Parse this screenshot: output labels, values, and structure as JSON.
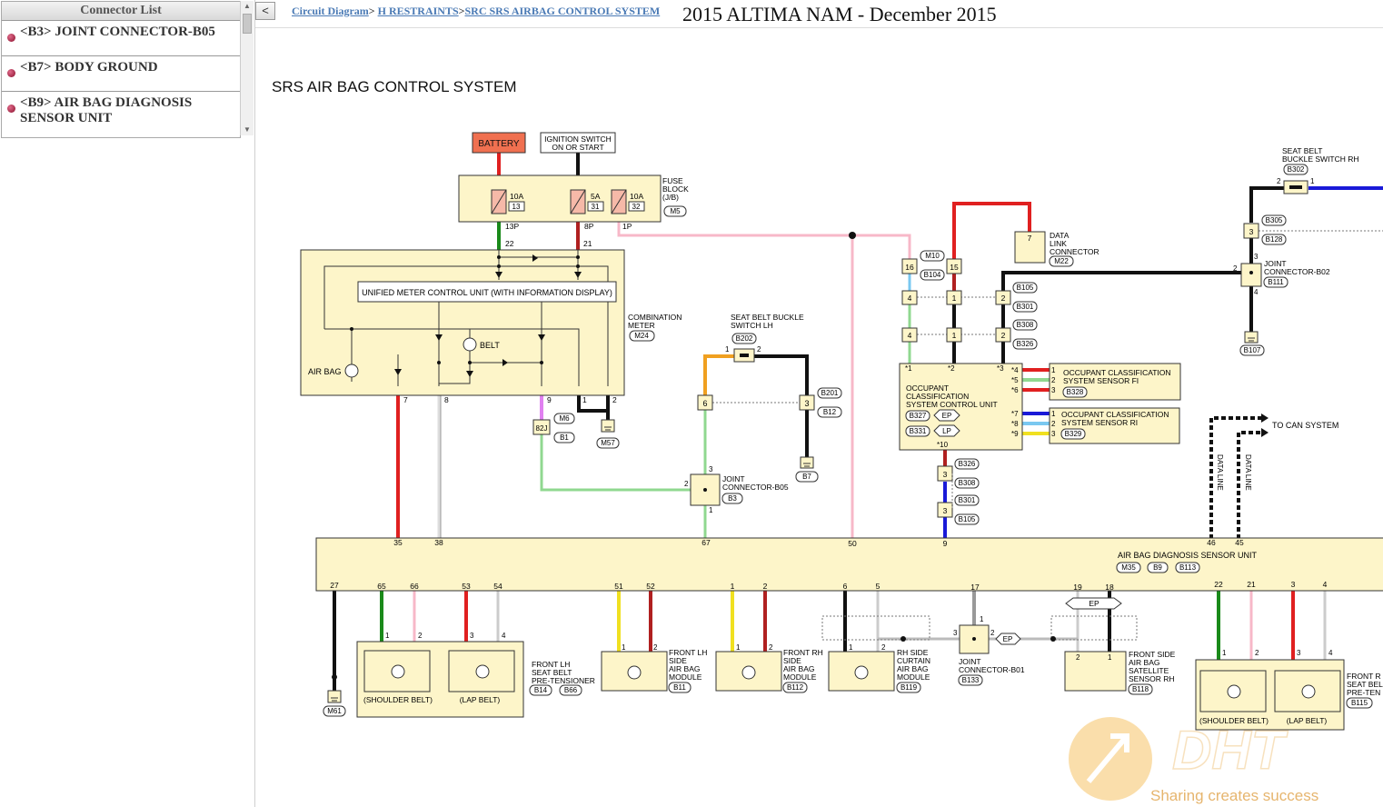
{
  "connector_list": {
    "header": "Connector List",
    "items": [
      {
        "label": "<B3> JOINT CONNECTOR-B05"
      },
      {
        "label": "<B7> BODY GROUND"
      },
      {
        "label_line1": "<B9> AIR BAG DIAGNOSIS",
        "label_line2": "SENSOR UNIT"
      }
    ]
  },
  "toolbar": {
    "collapse_label": "<"
  },
  "breadcrumb": {
    "link1": "Circuit Diagram",
    "sep": ">",
    "link2": "H RESTRAINTS",
    "link3": "SRC SRS AIRBAG CONTROL SYSTEM"
  },
  "doc_title": "2015 ALTIMA NAM - December 2015",
  "diagram": {
    "title": "SRS AIR BAG CONTROL SYSTEM",
    "battery": "BATTERY",
    "ignition": [
      "IGNITION SWITCH",
      "ON OR START"
    ],
    "fuse_block": [
      "FUSE",
      "BLOCK",
      "(J/B)"
    ],
    "fuse_block_conn": "M5",
    "fuses": [
      {
        "amp": "10A",
        "num": "13",
        "pin": "13P"
      },
      {
        "amp": "5A",
        "num": "31",
        "pin": "8P"
      },
      {
        "amp": "10A",
        "num": "32",
        "pin": "1P"
      }
    ],
    "unified_meter": "UNIFIED METER CONTROL UNIT (WITH INFORMATION DISPLAY)",
    "combination_meter": [
      "COMBINATION",
      "METER"
    ],
    "combination_meter_conn": "M24",
    "belt_label": "BELT",
    "airbag_label": "AIR BAG",
    "meter_pins": {
      "p22": "22",
      "p21": "21",
      "p7": "7",
      "p8": "8",
      "p9": "9",
      "p1": "1",
      "p2": "2"
    },
    "junction_82j": "82J",
    "conn_m6": "M6",
    "conn_b1": "B1",
    "conn_m57": "M57",
    "seat_buckle_lh": [
      "SEAT BELT BUCKLE",
      "SWITCH LH"
    ],
    "conn_b202": "B202",
    "conn_b201": "B201",
    "conn_b12": "B12",
    "conn_b7": "B7",
    "joint_b05": [
      "JOINT",
      "CONNECTOR-B05"
    ],
    "conn_b3": "B3",
    "pins_misc": {
      "p6": "6",
      "p3": "3",
      "p2": "2",
      "p1": "1",
      "p16": "16",
      "p15": "15",
      "p4": "4",
      "p7": "7"
    },
    "dlc": [
      "DATA",
      "LINK",
      "CONNECTOR"
    ],
    "conn_m22": "M22",
    "conn_m10": "M10",
    "conn_b104": "B104",
    "conn_b105": "B105",
    "conn_b301": "B301",
    "conn_b308": "B308",
    "conn_b326": "B326",
    "occupant_unit": [
      "OCCUPANT",
      "CLASSIFICATION",
      "SYSTEM CONTROL UNIT"
    ],
    "conn_b327": "B327",
    "conn_b331": "B331",
    "ep": "EP",
    "lp": "LP",
    "occ_pins": [
      "*1",
      "*2",
      "*3",
      "*4",
      "*5",
      "*6",
      "*7",
      "*8",
      "*9",
      "*10"
    ],
    "sensor_fi": [
      "OCCUPANT CLASSIFICATION",
      "SYSTEM SENSOR FI"
    ],
    "conn_b328": "B328",
    "sensor_ri": [
      "OCCUPANT CLASSIFICATION",
      "SYSTEM SENSOR RI"
    ],
    "conn_b329": "B329",
    "seat_buckle_rh": [
      "SEAT BELT",
      "BUCKLE SWITCH RH"
    ],
    "conn_b302": "B302",
    "conn_b305": "B305",
    "conn_b128": "B128",
    "joint_b02": [
      "JOINT",
      "CONNECTOR-B02"
    ],
    "conn_b111": "B111",
    "conn_b107": "B107",
    "to_can": "TO CAN SYSTEM",
    "data_line": "DATA LINE",
    "adsu": "AIR BAG DIAGNOSIS SENSOR UNIT",
    "conn_m35": "M35",
    "conn_b9": "B9",
    "conn_b113": "B113",
    "adsu_top_pins": [
      "35",
      "38",
      "67",
      "50",
      "9",
      "46",
      "45"
    ],
    "adsu_bottom_pins": [
      "27",
      "65",
      "66",
      "53",
      "54",
      "51",
      "52",
      "1",
      "2",
      "6",
      "5",
      "17",
      "19",
      "18",
      "22",
      "21",
      "3",
      "4"
    ],
    "conn_m61": "M61",
    "shoulder_belt": "(SHOULDER BELT)",
    "lap_belt": "(LAP BELT)",
    "front_lh_pretensioner": [
      "FRONT LH",
      "SEAT BELT",
      "PRE-TENSIONER"
    ],
    "conn_b14": "B14",
    "conn_b66": "B66",
    "front_lh_side": [
      "FRONT LH",
      "SIDE",
      "AIR BAG",
      "MODULE"
    ],
    "conn_b11": "B11",
    "front_rh_side": [
      "FRONT RH",
      "SIDE",
      "AIR BAG",
      "MODULE"
    ],
    "conn_b112": "B112",
    "rh_curtain": [
      "RH SIDE",
      "CURTAIN",
      "AIR BAG",
      "MODULE"
    ],
    "conn_b119": "B119",
    "joint_b01": [
      "JOINT",
      "CONNECTOR-B01"
    ],
    "conn_b133": "B133",
    "front_side_sat": [
      "FRONT SIDE",
      "AIR BAG",
      "SATELLITE",
      "SENSOR RH"
    ],
    "conn_b118": "B118",
    "front_rh_pretensioner": [
      "FRONT R",
      "SEAT BEL",
      "PRE-TEN"
    ],
    "conn_b115": "B115"
  },
  "watermark": {
    "logo_text": "DHT",
    "tagline": "Sharing creates success"
  },
  "colors": {
    "battery": "#f07050",
    "fill": "#fdf5c9",
    "link": "#4a7ab5",
    "red": "#e02020",
    "green": "#1a8a1a",
    "pink": "#f7b8c8",
    "ltgreen": "#90d890",
    "blue": "#1a1ad8",
    "orange": "#f0a020",
    "yellow": "#f0e020"
  }
}
